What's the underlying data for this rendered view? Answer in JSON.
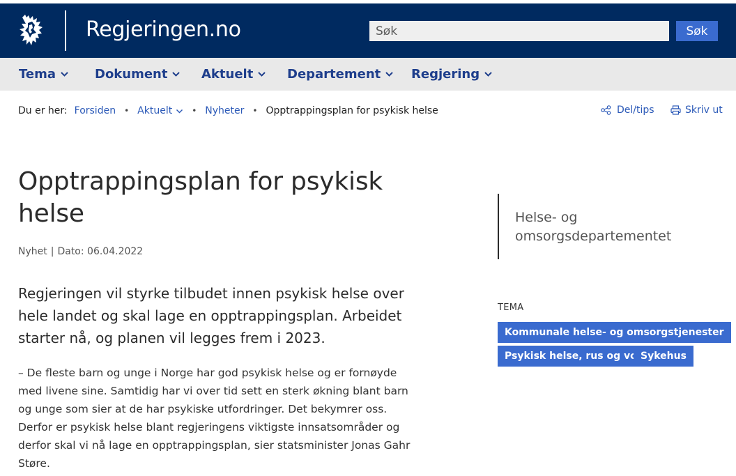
{
  "header": {
    "site_title": "Regjeringen.no",
    "search_placeholder": "Søk",
    "search_button": "Søk",
    "bg_color": "#002a60",
    "accent_color": "#3a6bcf"
  },
  "nav": {
    "items": [
      {
        "label": "Tema"
      },
      {
        "label": "Dokument"
      },
      {
        "label": "Aktuelt"
      },
      {
        "label": "Departement"
      },
      {
        "label": "Regjering"
      }
    ]
  },
  "breadcrumb": {
    "prefix": "Du er her:",
    "items": [
      {
        "label": "Forsiden"
      },
      {
        "label": "Aktuelt"
      },
      {
        "label": "Nyheter"
      }
    ],
    "current": "Opptrappingsplan for psykisk helse"
  },
  "actions": {
    "share": "Del/tips",
    "print": "Skriv ut"
  },
  "article": {
    "title": "Opptrappingsplan for psykisk helse",
    "type": "Nyhet",
    "date": "Dato: 06.04.2022",
    "lead": "Regjeringen vil styrke tilbudet innen psykisk helse over hele landet og skal lage en opptrappingsplan. Arbeidet starter nå, og planen vil legges frem i 2023.",
    "body": "– De fleste barn og unge i Norge har god psykisk helse og er fornøyde med livene sine. Samtidig har vi over tid sett en sterk økning blant barn og unge som sier at de har psykiske utfordringer. Det bekymrer oss. Derfor er psykisk helse blant regjeringens viktigste innsatsområder og derfor skal vi nå lage en opptrappingsplan, sier statsminister Jonas Gahr Støre."
  },
  "sidebar": {
    "department": "Helse- og omsorgsdepartementet",
    "tema_label": "TEMA",
    "tags": [
      {
        "label": "Kommunale helse- og omsorgstjenester"
      },
      {
        "label": "Psykisk helse, rus og vold"
      },
      {
        "label": "Sykehus"
      }
    ]
  }
}
